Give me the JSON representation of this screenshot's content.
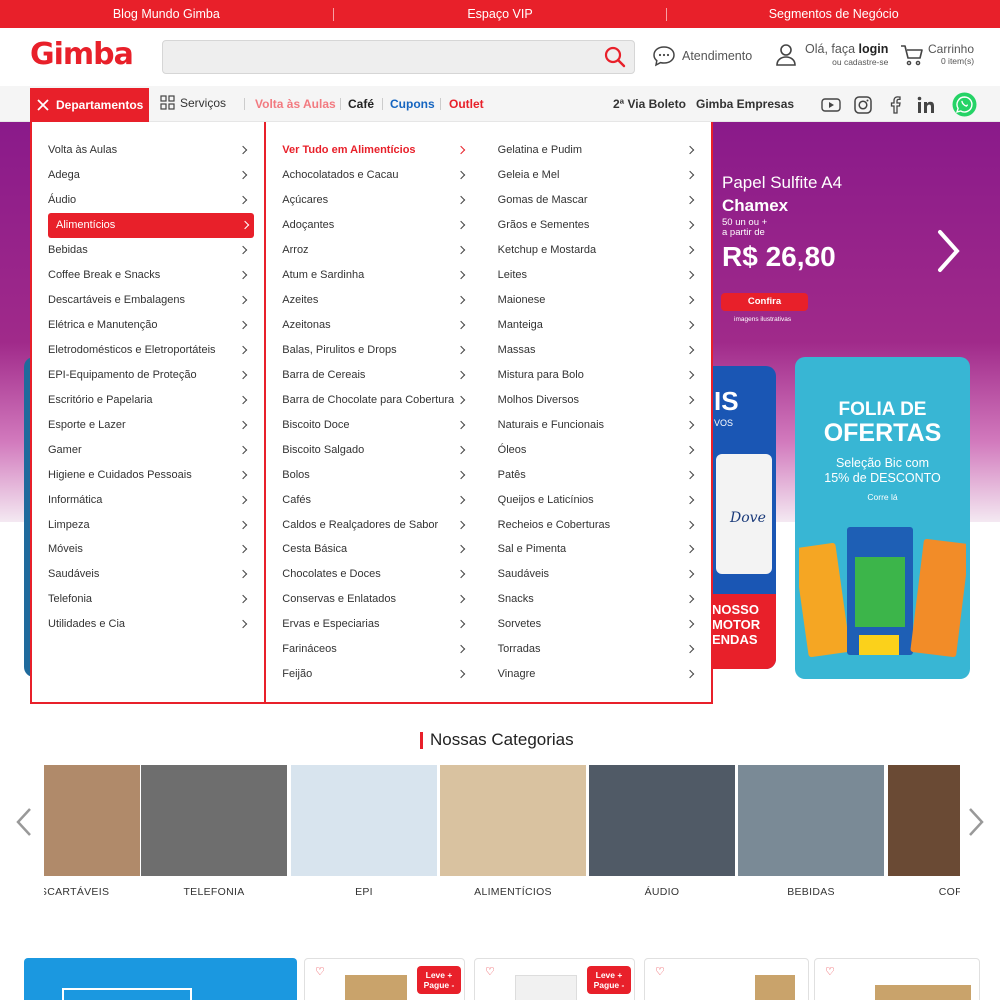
{
  "topbar": {
    "links": [
      "Blog Mundo Gimba",
      "Espaço VIP",
      "Segmentos de Negócio"
    ]
  },
  "header": {
    "logo": "Gimba",
    "search_placeholder": "",
    "atendimento": "Atendimento",
    "login_prefix": "Olá, faça ",
    "login_bold": "login",
    "login_sub": "ou cadastre-se",
    "cart_label": "Carrinho",
    "cart_count": "0 item(s)"
  },
  "nav": {
    "departamentos": "Departamentos",
    "servicos": "Serviços",
    "volta": "Volta às Aulas",
    "cafe": "Café",
    "cupons": "Cupons",
    "outlet": "Outlet",
    "boleto": "2ª Via Boleto",
    "empresas": "Gimba Empresas",
    "social_icons": [
      "youtube-icon",
      "instagram-icon",
      "facebook-icon",
      "linkedin-icon",
      "whatsapp-icon"
    ]
  },
  "hero": {
    "product": "Papel Sulfite A4",
    "brand": "Chamex",
    "desc_line1": "50 un ou +",
    "desc_line2": "a partir de",
    "price": "R$ 26,80",
    "button": "Confira",
    "note": "imagens ilustrativas"
  },
  "promo_dove": {
    "big": "IS",
    "small": "VOS",
    "brand": "Dove",
    "red_line1": "NOSSO",
    "red_line2": "MOTOR",
    "red_line3": "ENDAS"
  },
  "promo_bic": {
    "line1": "FOLIA DE",
    "line2": "OFERTAS",
    "line3": "Seleção Bic com",
    "line4": "15% de DESCONTO",
    "cta": "Corre lá"
  },
  "menu": {
    "departments": [
      "Volta às Aulas",
      "Adega",
      "Áudio",
      "Alimentícios",
      "Bebidas",
      "Coffee Break e Snacks",
      "Descartáveis e Embalagens",
      "Elétrica e Manutenção",
      "Eletrodomésticos e Eletroportáteis",
      "EPI-Equipamento de Proteção",
      "Escritório e Papelaria",
      "Esporte e Lazer",
      "Gamer",
      "Higiene e Cuidados Pessoais",
      "Informática",
      "Limpeza",
      "Móveis",
      "Saudáveis",
      "Telefonia",
      "Utilidades e Cia"
    ],
    "active_index": 3,
    "sub_col1": [
      "Ver Tudo em Alimentícios",
      "Achocolatados e Cacau",
      "Açúcares",
      "Adoçantes",
      "Arroz",
      "Atum e Sardinha",
      "Azeites",
      "Azeitonas",
      "Balas, Pirulitos e Drops",
      "Barra de Cereais",
      "Barra de Chocolate para Cobertura",
      "Biscoito Doce",
      "Biscoito Salgado",
      "Bolos",
      "Cafés",
      "Caldos e Realçadores de Sabor",
      "Cesta Básica",
      "Chocolates e Doces",
      "Conservas e Enlatados",
      "Ervas e Especiarias",
      "Farináceos",
      "Feijão"
    ],
    "sub_col2": [
      "Gelatina e Pudim",
      "Geleia e Mel",
      "Gomas de Mascar",
      "Grãos e Sementes",
      "Ketchup e Mostarda",
      "Leites",
      "Maionese",
      "Manteiga",
      "Massas",
      "Mistura para Bolo",
      "Molhos Diversos",
      "Naturais e Funcionais",
      "Óleos",
      "Patês",
      "Queijos e Laticínios",
      "Recheios e Coberturas",
      "Sal e Pimenta",
      "Saudáveis",
      "Snacks",
      "Sorvetes",
      "Torradas",
      "Vinagre"
    ]
  },
  "categories": {
    "title": "Nossas Categorias",
    "items": [
      "DESCARTÁVEIS",
      "TELEFONIA",
      "EPI",
      "ALIMENTÍCIOS",
      "ÁUDIO",
      "BEBIDAS",
      "COFFEE"
    ]
  },
  "bottom_cards": {
    "badge_line1": "Leve +",
    "badge_line2": "Pague -",
    "heart": "♡"
  }
}
